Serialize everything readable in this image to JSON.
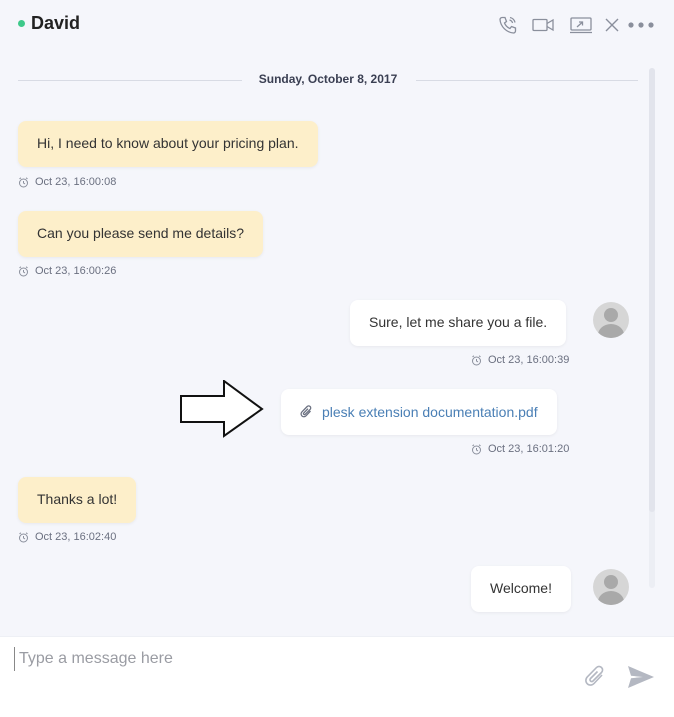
{
  "header": {
    "contact_name": "David",
    "status_color": "#3ec98a",
    "icons": [
      "phone-icon",
      "video-icon",
      "screen-share-icon",
      "close-icon",
      "more-icon"
    ]
  },
  "date_divider": "Sunday, October 8, 2017",
  "messages": [
    {
      "direction": "incoming",
      "text": "Hi, I need to know about your pricing plan.",
      "time": "Oct 23, 16:00:08"
    },
    {
      "direction": "incoming",
      "text": "Can you please send me details?",
      "time": "Oct 23, 16:00:26"
    },
    {
      "direction": "outgoing",
      "text": "Sure, let me share you a file.",
      "time": "Oct 23, 16:00:39"
    },
    {
      "direction": "outgoing",
      "type": "file",
      "text": "plesk extension documentation.pdf",
      "time": "Oct 23, 16:01:20"
    },
    {
      "direction": "incoming",
      "text": "Thanks a lot!",
      "time": "Oct 23, 16:02:40"
    },
    {
      "direction": "outgoing",
      "text": "Welcome!",
      "time": ""
    }
  ],
  "composer": {
    "placeholder": "Type a message here",
    "value": ""
  },
  "colors": {
    "incoming_bubble": "#fdefca",
    "outgoing_bubble": "#ffffff",
    "file_link": "#4a7fb5",
    "background": "#f5f6fb"
  }
}
